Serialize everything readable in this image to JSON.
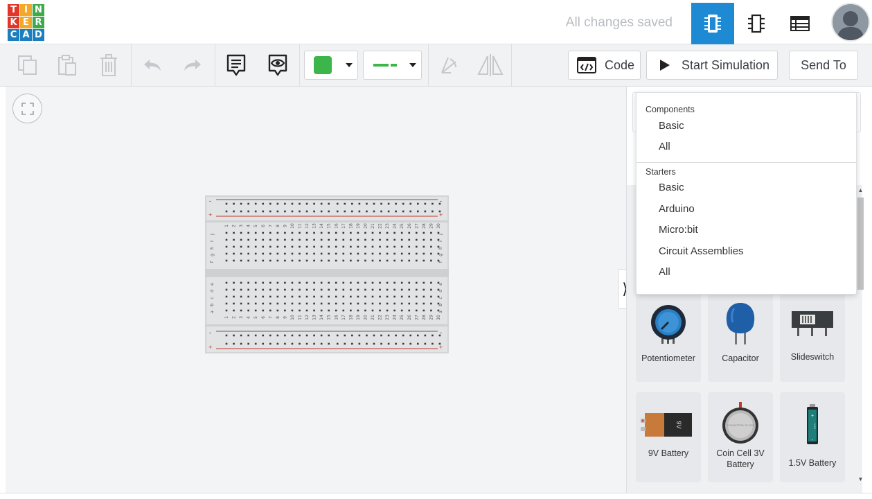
{
  "app": {
    "logo_letters": [
      "T",
      "I",
      "N",
      "K",
      "E",
      "R",
      "C",
      "A",
      "D"
    ],
    "logo_colors": [
      "#e3352a",
      "#f3a829",
      "#3eaa49",
      "#e3352a",
      "#f3a829",
      "#3eaa49",
      "#1a7fc0",
      "#1a7fc0",
      "#1a7fc0"
    ],
    "status_text": "All changes saved",
    "accent_color": "#1e8ad4"
  },
  "toolbar": {
    "code_label": "Code",
    "start_sim_label": "Start Simulation",
    "send_to_label": "Send To",
    "fill_color": "#3cb54a",
    "wire_color": "#3cb54a"
  },
  "dropdown": {
    "components_heading": "Components",
    "components": [
      "Basic",
      "All"
    ],
    "starters_heading": "Starters",
    "starters": [
      "Basic",
      "Arduino",
      "Micro:bit",
      "Circuit Assemblies",
      "All"
    ]
  },
  "components": [
    {
      "label": "Potentiometer",
      "icon": "potentiometer-icon"
    },
    {
      "label": "Capacitor",
      "icon": "capacitor-icon"
    },
    {
      "label": "Slideswitch",
      "icon": "slideswitch-icon"
    },
    {
      "label": "9V Battery",
      "icon": "9v-battery-icon",
      "text": "9V"
    },
    {
      "label": "Coin Cell 3V Battery",
      "icon": "coin-cell-icon",
      "text": "COIN BATTERY 3V 2032"
    },
    {
      "label": "1.5V Battery",
      "icon": "aa-battery-icon",
      "text": "1.5V"
    }
  ],
  "breadboard": {
    "minus_label": "-",
    "plus_label": "+",
    "top_row_letters": [
      "j",
      "i",
      "h",
      "g",
      "f"
    ],
    "bottom_row_letters": [
      "e",
      "d",
      "c",
      "b",
      "a"
    ],
    "column_count": 30
  }
}
